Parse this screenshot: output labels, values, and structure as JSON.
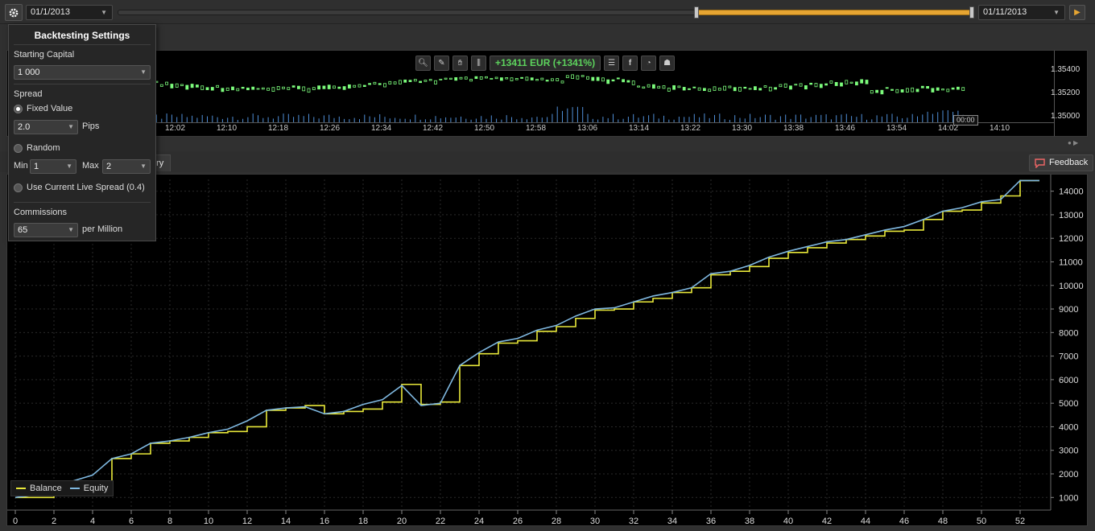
{
  "toolbar": {
    "start_date": "01/1/2013",
    "end_date": "01/11/2013",
    "range_selection": {
      "start_fraction": 0.676,
      "end_fraction": 1.0
    }
  },
  "mini_chart": {
    "pnl": "+13411 EUR (+1341%)",
    "price_labels": [
      "1.35400",
      "1.35200",
      "1.35000"
    ],
    "time_labels": [
      "12:02",
      "12:10",
      "12:18",
      "12:26",
      "12:34",
      "12:42",
      "12:50",
      "12:58",
      "13:06",
      "13:14",
      "13:22",
      "13:30",
      "13:38",
      "13:46",
      "13:54",
      "14:02",
      "14:10"
    ],
    "cursor_time": "00:00",
    "tool_icons": [
      "zoom-icon",
      "chart-edit-icon",
      "hand-icon",
      "candles-icon",
      "list-icon",
      "facebook-icon",
      "pie-icon",
      "profile-icon"
    ]
  },
  "tabs": {
    "history_partial": "ory"
  },
  "feedback": {
    "label": "Feedback"
  },
  "settings": {
    "title": "Backtesting Settings",
    "starting_capital_label": "Starting Capital",
    "starting_capital_value": "1 000",
    "spread_label": "Spread",
    "fixed_value_label": "Fixed Value",
    "fixed_value": "2.0",
    "pips_label": "Pips",
    "random_label": "Random",
    "min_label": "Min",
    "min_value": "1",
    "max_label": "Max",
    "max_value": "2",
    "live_spread_label": "Use Current Live Spread (0.4)",
    "commissions_label": "Commissions",
    "commissions_value": "65",
    "per_million_label": "per Million",
    "selected_spread_mode": "fixed"
  },
  "colors": {
    "balance": "#e8e83a",
    "equity": "#7fb8e0",
    "accent": "#e6a532",
    "pnl": "#5dd35d"
  },
  "chart_data": {
    "type": "line",
    "legend": [
      "Balance",
      "Equity"
    ],
    "legend_position": "bottom-left",
    "x_ticks": [
      0,
      2,
      4,
      6,
      8,
      10,
      12,
      14,
      16,
      18,
      20,
      22,
      24,
      26,
      28,
      30,
      32,
      34,
      36,
      38,
      40,
      42,
      44,
      46,
      48,
      50,
      52
    ],
    "y_ticks": [
      1000,
      2000,
      3000,
      4000,
      5000,
      6000,
      7000,
      8000,
      9000,
      10000,
      11000,
      12000,
      13000,
      14000
    ],
    "xlim": [
      0,
      53.5
    ],
    "ylim": [
      600,
      14500
    ],
    "series": [
      {
        "name": "Equity",
        "x": [
          0,
          1,
          2,
          3,
          4,
          5,
          6,
          7,
          8,
          9,
          10,
          11,
          12,
          13,
          14,
          15,
          16,
          17,
          18,
          19,
          20,
          21,
          22,
          23,
          24,
          25,
          26,
          27,
          28,
          29,
          30,
          31,
          32,
          33,
          34,
          35,
          36,
          37,
          38,
          39,
          40,
          41,
          42,
          43,
          44,
          45,
          46,
          47,
          48,
          49,
          50,
          51,
          52,
          53
        ],
        "values": [
          1000,
          1100,
          1400,
          1700,
          1950,
          2650,
          2850,
          3300,
          3400,
          3550,
          3750,
          3900,
          4250,
          4700,
          4800,
          4850,
          4550,
          4650,
          4950,
          5150,
          5750,
          4900,
          5000,
          6600,
          7150,
          7600,
          7750,
          8100,
          8300,
          8700,
          9000,
          9050,
          9300,
          9550,
          9700,
          9900,
          10500,
          10600,
          10850,
          11200,
          11450,
          11650,
          11850,
          11950,
          12150,
          12350,
          12500,
          12800,
          13150,
          13300,
          13550,
          13650,
          14450,
          14450
        ]
      },
      {
        "name": "Balance",
        "x": [
          0,
          1,
          2,
          3,
          4,
          5,
          6,
          7,
          8,
          9,
          10,
          11,
          12,
          13,
          14,
          15,
          16,
          17,
          18,
          19,
          20,
          21,
          22,
          23,
          24,
          25,
          26,
          27,
          28,
          29,
          30,
          31,
          32,
          33,
          34,
          35,
          36,
          37,
          38,
          39,
          40,
          41,
          42,
          43,
          44,
          45,
          46,
          47,
          48,
          49,
          50,
          51,
          52,
          53
        ],
        "values": [
          1000,
          1000,
          1400,
          1650,
          1650,
          2650,
          2850,
          3300,
          3400,
          3550,
          3750,
          3800,
          4000,
          4700,
          4800,
          4900,
          4550,
          4650,
          4750,
          5050,
          5800,
          4950,
          5050,
          6600,
          7100,
          7550,
          7650,
          8050,
          8250,
          8600,
          8950,
          9000,
          9300,
          9450,
          9700,
          9900,
          10450,
          10600,
          10800,
          11150,
          11400,
          11600,
          11800,
          11950,
          12100,
          12300,
          12350,
          12800,
          13150,
          13200,
          13500,
          13800,
          14450,
          14450
        ]
      }
    ]
  }
}
